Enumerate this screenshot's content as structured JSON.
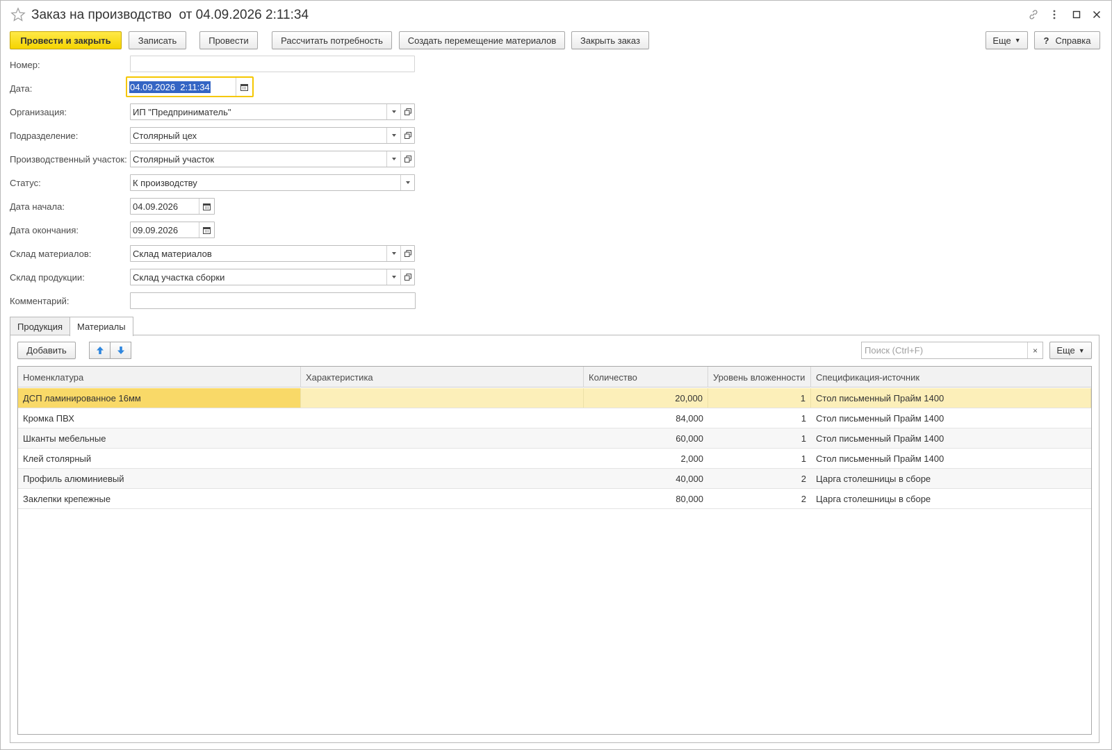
{
  "window": {
    "title": "Заказ на производство  от 04.09.2026 2:11:34"
  },
  "toolbar": {
    "post_close": "Провести и закрыть",
    "save": "Записать",
    "post": "Провести",
    "calc_need": "Рассчитать потребность",
    "create_move": "Создать перемещение материалов",
    "close_order": "Закрыть заказ",
    "more": "Еще",
    "help": "Справка",
    "help_glyph": "?"
  },
  "form": {
    "number_label": "Номер:",
    "number_value": "",
    "date_label": "Дата:",
    "date_value": "04.09.2026  2:11:34",
    "org_label": "Организация:",
    "org_value": "ИП \"Предприниматель\"",
    "dept_label": "Подразделение:",
    "dept_value": "Столярный цех",
    "site_label": "Производственный участок:",
    "site_value": "Столярный участок",
    "status_label": "Статус:",
    "status_value": "К производству",
    "start_label": "Дата начала:",
    "start_value": "04.09.2026",
    "end_label": "Дата окончания:",
    "end_value": "09.09.2026",
    "mat_wh_label": "Склад материалов:",
    "mat_wh_value": "Склад материалов",
    "prod_wh_label": "Склад продукции:",
    "prod_wh_value": "Склад участка сборки",
    "comment_label": "Комментарий:",
    "comment_value": ""
  },
  "tabs": [
    {
      "label": "Продукция",
      "active": false
    },
    {
      "label": "Материалы",
      "active": true
    }
  ],
  "materials": {
    "add_label": "Добавить",
    "search_placeholder": "Поиск (Ctrl+F)",
    "clear_glyph": "×",
    "more": "Еще",
    "columns": [
      "Номенклатура",
      "Характеристика",
      "Количество",
      "Уровень вложенности",
      "Спецификация-источник"
    ],
    "rows": [
      {
        "name": "ДСП ламинированное 16мм",
        "characteristic": "",
        "qty": "20,000",
        "level": "1",
        "spec": "Стол письменный Прайм 1400"
      },
      {
        "name": "Кромка ПВХ",
        "characteristic": "",
        "qty": "84,000",
        "level": "1",
        "spec": "Стол письменный Прайм 1400"
      },
      {
        "name": "Шканты мебельные",
        "characteristic": "",
        "qty": "60,000",
        "level": "1",
        "spec": "Стол письменный Прайм 1400"
      },
      {
        "name": "Клей столярный",
        "characteristic": "",
        "qty": "2,000",
        "level": "1",
        "spec": "Стол письменный Прайм 1400"
      },
      {
        "name": "Профиль алюминиевый",
        "characteristic": "",
        "qty": "40,000",
        "level": "2",
        "spec": "Царга столешницы в сборе"
      },
      {
        "name": "Заклепки крепежные",
        "characteristic": "",
        "qty": "80,000",
        "level": "2",
        "spec": "Царга столешницы в сборе"
      }
    ],
    "selected_row": 0
  },
  "colors": {
    "primary_button": "#f5d400",
    "focus_border": "#f5c700",
    "selection": "#3465c4",
    "row_selected": "#fcefb9",
    "cell_selected": "#f9d968",
    "arrow_blue": "#2e86de"
  },
  "icons": [
    "star-icon",
    "link-icon",
    "more-vertical-icon",
    "maximize-icon",
    "close-icon",
    "calendar-icon",
    "chevron-down-icon",
    "open-form-icon",
    "arrow-up-icon",
    "arrow-down-icon"
  ]
}
